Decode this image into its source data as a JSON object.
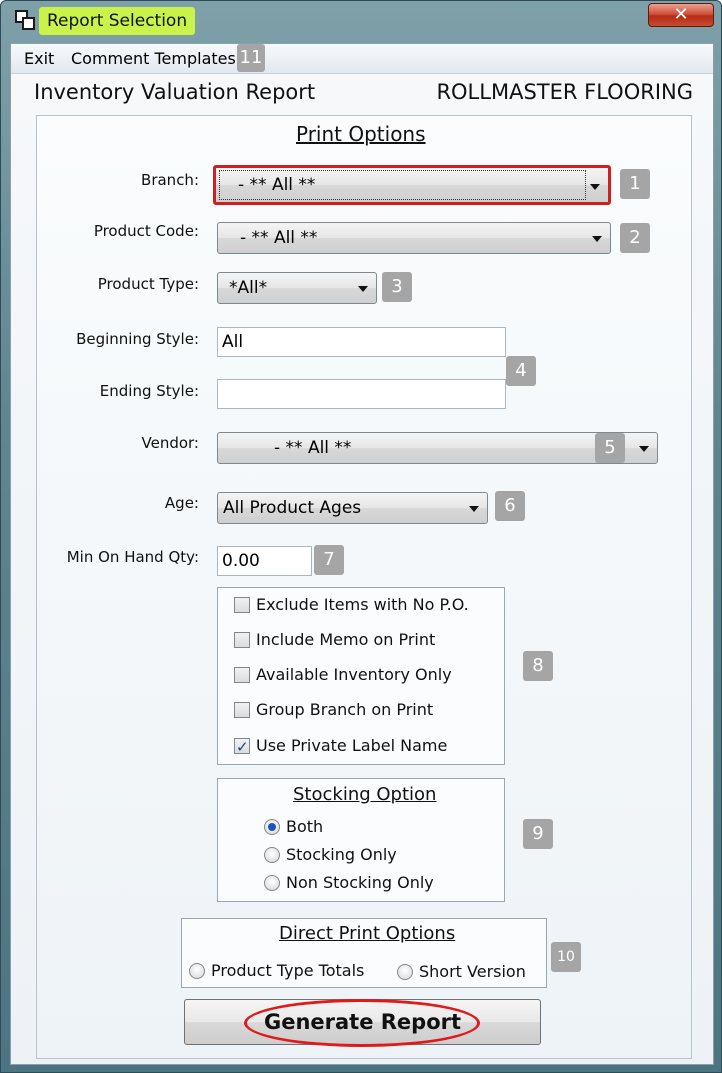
{
  "window": {
    "title": "Report Selection",
    "close_label": "✕"
  },
  "menu": {
    "exit": "Exit",
    "comment_templates": "Comment Templates",
    "comment_templates_badge": "11"
  },
  "header": {
    "report_title": "Inventory Valuation Report",
    "company": "ROLLMASTER FLOORING"
  },
  "print_options": {
    "title": "Print Options",
    "branch": {
      "label": "Branch:",
      "value": "- ** All **",
      "badge": "1"
    },
    "product_code": {
      "label": "Product Code:",
      "value": "- ** All **",
      "badge": "2"
    },
    "product_type": {
      "label": "Product Type:",
      "value": "*All*",
      "badge": "3"
    },
    "beginning_style": {
      "label": "Beginning Style:",
      "value": "All"
    },
    "ending_style": {
      "label": "Ending Style:",
      "value": ""
    },
    "style_badge": "4",
    "vendor": {
      "label": "Vendor:",
      "value": "- ** All **",
      "badge": "5"
    },
    "age": {
      "label": "Age:",
      "value": "All Product Ages",
      "badge": "6"
    },
    "min_on_hand": {
      "label": "Min On Hand Qty:",
      "value": "0.00",
      "badge": "7"
    },
    "checkbox_badge": "8",
    "checkboxes": [
      {
        "label": "Exclude Items with No P.O.",
        "checked": false
      },
      {
        "label": "Include Memo on Print",
        "checked": false
      },
      {
        "label": "Available Inventory Only",
        "checked": false
      },
      {
        "label": "Group Branch on Print",
        "checked": false
      },
      {
        "label": "Use Private Label Name",
        "checked": true
      }
    ],
    "stocking": {
      "title": "Stocking Option",
      "badge": "9",
      "options": [
        {
          "label": "Both",
          "checked": true
        },
        {
          "label": "Stocking Only",
          "checked": false
        },
        {
          "label": "Non Stocking Only",
          "checked": false
        }
      ]
    },
    "direct_print": {
      "title": "Direct Print Options",
      "badge": "10",
      "options": [
        {
          "label": "Product Type Totals",
          "checked": false
        },
        {
          "label": "Short Version",
          "checked": false
        }
      ]
    },
    "generate_label": "Generate Report"
  },
  "colors": {
    "highlight_title": "#c9f24a",
    "focus_red": "#d01f1f",
    "badge_gray": "#a5a5a5"
  }
}
